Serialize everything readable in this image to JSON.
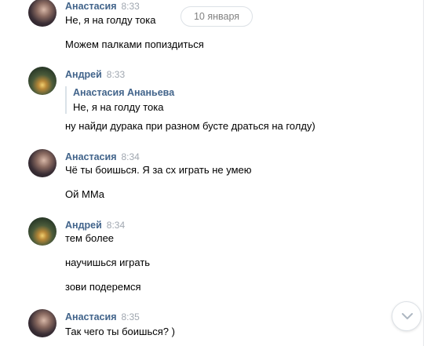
{
  "date_separator": "10 января",
  "messages": [
    {
      "author": "Анастасия",
      "time": "8:33",
      "avatar": "anastasia-avatar",
      "lines": [
        "Не, я на голду тока",
        "Можем палками попиздиться"
      ]
    },
    {
      "author": "Андрей",
      "time": "8:33",
      "avatar": "andrey-avatar",
      "quote": {
        "author": "Анастасия Ананьева",
        "text": "Не, я на голду тока"
      },
      "lines": [
        "ну найди дурака при разном бусте драться на голду)"
      ]
    },
    {
      "author": "Анастасия",
      "time": "8:34",
      "avatar": "anastasia-avatar",
      "lines": [
        "Чё ты боишься. Я за сх играть не умею",
        "Ой ММа"
      ]
    },
    {
      "author": "Андрей",
      "time": "8:34",
      "avatar": "andrey-avatar",
      "lines": [
        "тем более",
        "научишься играть",
        "зови подеремся"
      ]
    },
    {
      "author": "Анастасия",
      "time": "8:35",
      "avatar": "anastasia-avatar",
      "lines": [
        "Так чего ты боишься? )"
      ]
    }
  ],
  "icons": {
    "scroll_down": "chevron-down-icon"
  },
  "colors": {
    "author": "#42648b",
    "time": "#a0a7b0",
    "quote_bar": "#dae2e8",
    "date_pill_border": "#dce1e6"
  }
}
